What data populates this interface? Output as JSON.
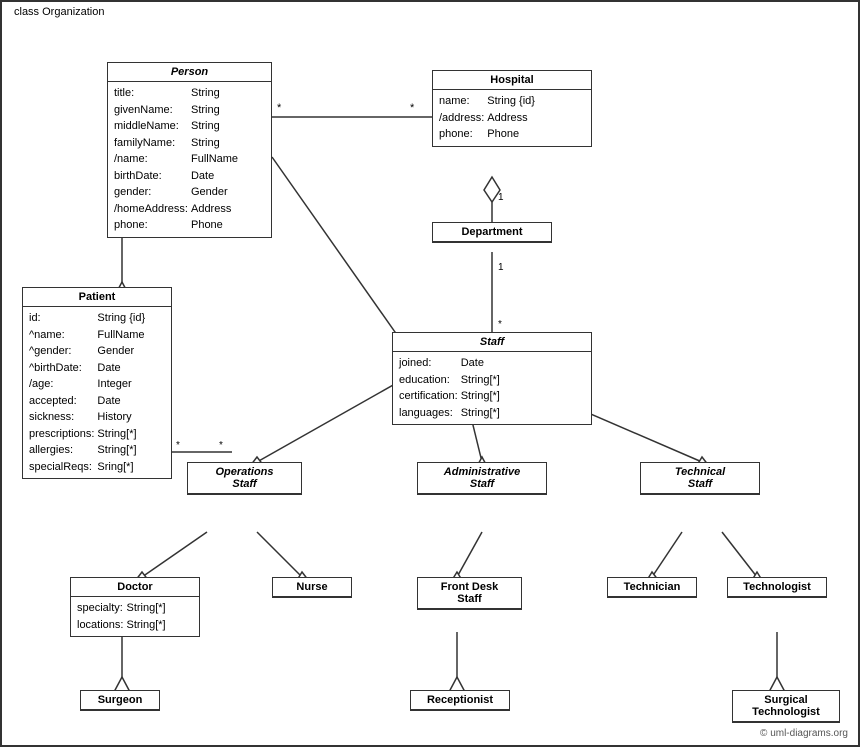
{
  "diagram": {
    "title": "class Organization",
    "classes": {
      "person": {
        "name": "Person",
        "italic": true,
        "attributes": [
          [
            "title:",
            "String"
          ],
          [
            "givenName:",
            "String"
          ],
          [
            "middleName:",
            "String"
          ],
          [
            "familyName:",
            "String"
          ],
          [
            "/name:",
            "FullName"
          ],
          [
            "birthDate:",
            "Date"
          ],
          [
            "gender:",
            "Gender"
          ],
          [
            "/homeAddress:",
            "Address"
          ],
          [
            "phone:",
            "Phone"
          ]
        ]
      },
      "hospital": {
        "name": "Hospital",
        "italic": false,
        "attributes": [
          [
            "name:",
            "String {id}"
          ],
          [
            "/address:",
            "Address"
          ],
          [
            "phone:",
            "Phone"
          ]
        ]
      },
      "patient": {
        "name": "Patient",
        "italic": false,
        "attributes": [
          [
            "id:",
            "String {id}"
          ],
          [
            "^name:",
            "FullName"
          ],
          [
            "^gender:",
            "Gender"
          ],
          [
            "^birthDate:",
            "Date"
          ],
          [
            "/age:",
            "Integer"
          ],
          [
            "accepted:",
            "Date"
          ],
          [
            "sickness:",
            "History"
          ],
          [
            "prescriptions:",
            "String[*]"
          ],
          [
            "allergies:",
            "String[*]"
          ],
          [
            "specialReqs:",
            "Sring[*]"
          ]
        ]
      },
      "department": {
        "name": "Department",
        "italic": false,
        "attributes": []
      },
      "staff": {
        "name": "Staff",
        "italic": true,
        "attributes": [
          [
            "joined:",
            "Date"
          ],
          [
            "education:",
            "String[*]"
          ],
          [
            "certification:",
            "String[*]"
          ],
          [
            "languages:",
            "String[*]"
          ]
        ]
      },
      "operations_staff": {
        "name": "Operations\nStaff",
        "italic": true,
        "attributes": []
      },
      "administrative_staff": {
        "name": "Administrative\nStaff",
        "italic": true,
        "attributes": []
      },
      "technical_staff": {
        "name": "Technical\nStaff",
        "italic": true,
        "attributes": []
      },
      "doctor": {
        "name": "Doctor",
        "italic": false,
        "attributes": [
          [
            "specialty:",
            "String[*]"
          ],
          [
            "locations:",
            "String[*]"
          ]
        ]
      },
      "nurse": {
        "name": "Nurse",
        "italic": false,
        "attributes": []
      },
      "front_desk_staff": {
        "name": "Front Desk\nStaff",
        "italic": false,
        "attributes": []
      },
      "technician": {
        "name": "Technician",
        "italic": false,
        "attributes": []
      },
      "technologist": {
        "name": "Technologist",
        "italic": false,
        "attributes": []
      },
      "surgeon": {
        "name": "Surgeon",
        "italic": false,
        "attributes": []
      },
      "receptionist": {
        "name": "Receptionist",
        "italic": false,
        "attributes": []
      },
      "surgical_technologist": {
        "name": "Surgical\nTechnologist",
        "italic": false,
        "attributes": []
      }
    },
    "copyright": "© uml-diagrams.org"
  }
}
